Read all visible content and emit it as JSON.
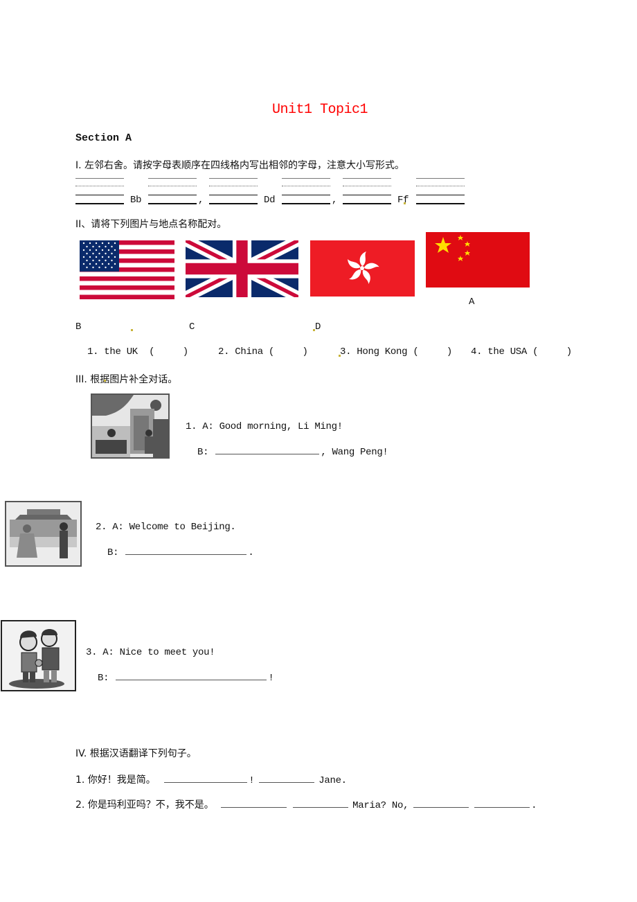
{
  "title": "Unit1 Topic1",
  "section": "Section A",
  "part1": {
    "heading": "I. 左邻右舍。请按字母表顺序在四线格内写出相邻的字母，注意大小写形式。",
    "letters": [
      "Bb",
      "Dd",
      "Ff"
    ],
    "separators": [
      ",",
      ","
    ]
  },
  "part2": {
    "heading": "II、请将下列图片与地点名称配对。",
    "flags": [
      {
        "name": "USA flag",
        "label": "B"
      },
      {
        "name": "UK flag",
        "label": "C"
      },
      {
        "name": "Hong Kong flag",
        "label": "D"
      },
      {
        "name": "China flag",
        "label": "A"
      }
    ],
    "items": [
      {
        "text": "1. the UK  (     )"
      },
      {
        "text": "2. China (     )"
      },
      {
        "text": "3. Hong Kong (     )"
      },
      {
        "text": "4. the USA (     )"
      }
    ],
    "colors": {
      "red": "#e8002a",
      "blue": "#0a2a6b",
      "yellow": "#ffdd00"
    }
  },
  "part3": {
    "heading": "III. 根据图片补全对话。",
    "dialogs": [
      {
        "a": "1. A: Good morning, Li Ming!",
        "b_prefix": "B:",
        "b_suffix": ", Wang Peng!",
        "picture": "office scene"
      },
      {
        "a": "2. A: Welcome to Beijing.",
        "b_prefix": "B:",
        "b_suffix": ".",
        "picture": "Tiananmen scene"
      },
      {
        "a": "3. A: Nice to meet you!",
        "b_prefix": "B:",
        "b_suffix": "!",
        "picture": "two people shaking hands"
      }
    ]
  },
  "part4": {
    "heading": "IV. 根据汉语翻译下列句子。",
    "sentences": [
      {
        "cn": "1. 你好！我是简。",
        "mid": "!",
        "end": "Jane."
      },
      {
        "cn": "2. 你是玛利亚吗？不，我不是。",
        "mid": "Maria? No,",
        "end": "."
      }
    ]
  }
}
